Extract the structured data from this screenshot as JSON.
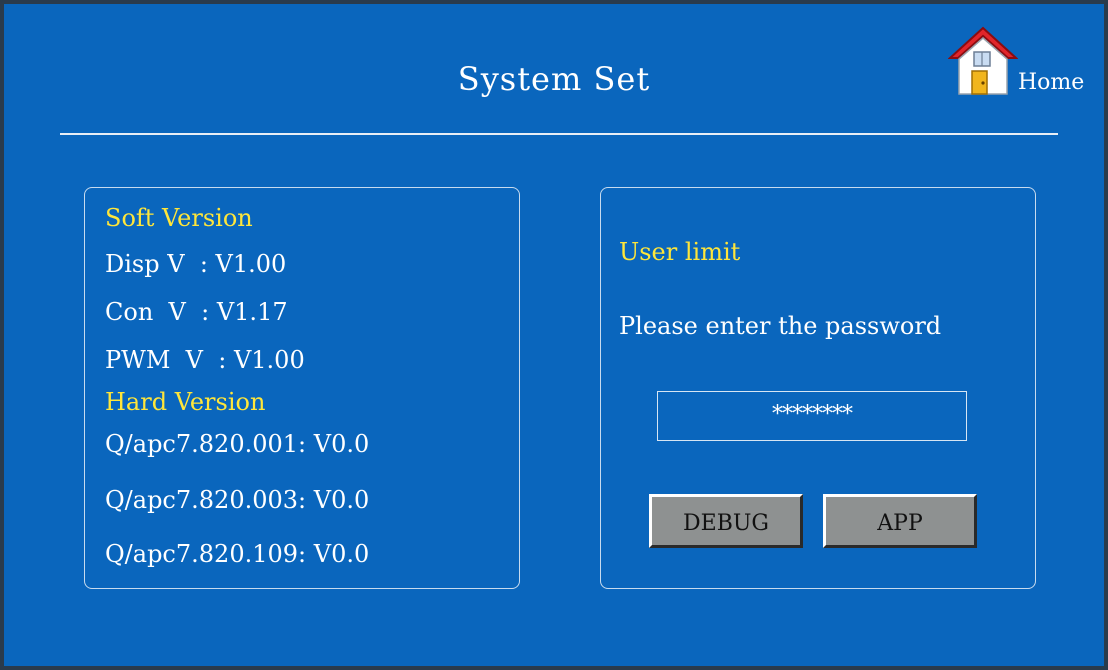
{
  "header": {
    "title": "System Set",
    "home_label": "Home"
  },
  "soft_version": {
    "heading": "Soft Version",
    "items": [
      "Disp V  : V1.00",
      "Con  V  : V1.17",
      "PWM  V  : V1.00"
    ]
  },
  "hard_version": {
    "heading": "Hard Version",
    "items": [
      "Q/apc7.820.001: V0.0",
      "Q/apc7.820.003: V0.0",
      "Q/apc7.820.109: V0.0"
    ]
  },
  "user_limit": {
    "heading": "User limit",
    "prompt": "Please enter the password",
    "password_value": "********",
    "buttons": {
      "debug": "DEBUG",
      "app": "APP"
    }
  },
  "colors": {
    "background": "#0a66bd",
    "heading_yellow": "#ffe63a",
    "text": "#ffffff",
    "button": "#8e9191"
  },
  "icons": {
    "home": "home-icon"
  }
}
